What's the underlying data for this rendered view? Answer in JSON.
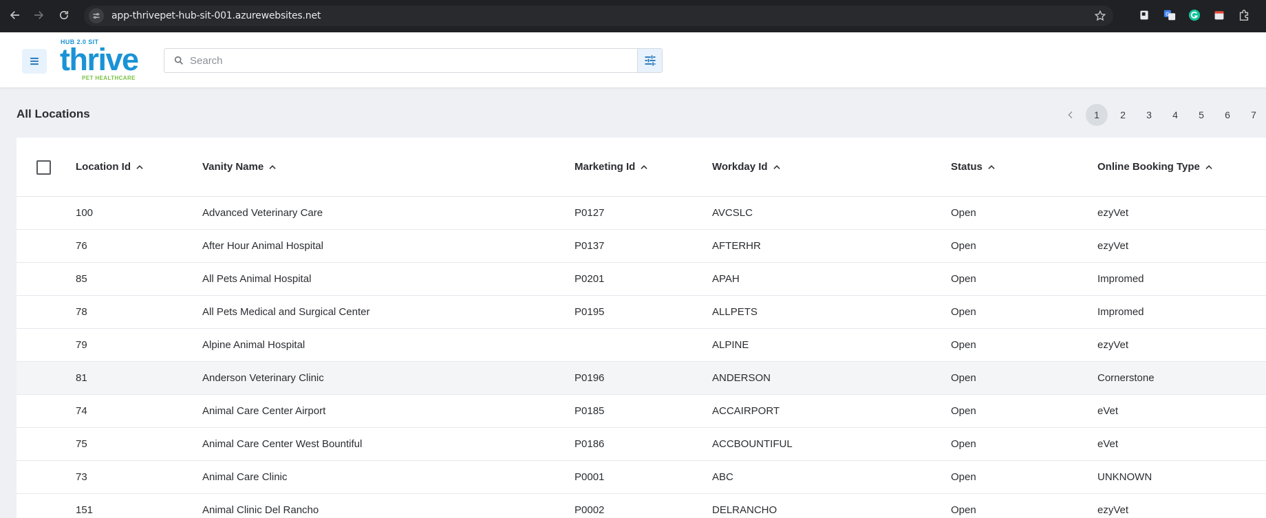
{
  "browser": {
    "url": "app-thrivepet-hub-sit-001.azurewebsites.net"
  },
  "header": {
    "logo_sub": "HUB 2.0 SIT",
    "logo_word": "thrive",
    "logo_tag": "PET HEALTHCARE",
    "search_placeholder": "Search"
  },
  "page": {
    "title": "All Locations"
  },
  "pagination": {
    "pages": [
      "1",
      "2",
      "3",
      "4",
      "5",
      "6",
      "7"
    ],
    "current": "1"
  },
  "table": {
    "columns": [
      "Location Id",
      "Vanity Name",
      "Marketing Id",
      "Workday Id",
      "Status",
      "Online Booking Type"
    ],
    "rows": [
      [
        "100",
        "Advanced Veterinary Care",
        "P0127",
        "AVCSLC",
        "Open",
        "ezyVet"
      ],
      [
        "76",
        "After Hour Animal Hospital",
        "P0137",
        "AFTERHR",
        "Open",
        "ezyVet"
      ],
      [
        "85",
        "All Pets Animal Hospital",
        "P0201",
        "APAH",
        "Open",
        "Impromed"
      ],
      [
        "78",
        "All Pets Medical and Surgical Center",
        "P0195",
        "ALLPETS",
        "Open",
        "Impromed"
      ],
      [
        "79",
        "Alpine Animal Hospital",
        "",
        "ALPINE",
        "Open",
        "ezyVet"
      ],
      [
        "81",
        "Anderson Veterinary Clinic",
        "P0196",
        "ANDERSON",
        "Open",
        "Cornerstone"
      ],
      [
        "74",
        "Animal Care Center Airport",
        "P0185",
        "ACCAIRPORT",
        "Open",
        "eVet"
      ],
      [
        "75",
        "Animal Care Center West Bountiful",
        "P0186",
        "ACCBOUNTIFUL",
        "Open",
        "eVet"
      ],
      [
        "73",
        "Animal Care Clinic",
        "P0001",
        "ABC",
        "Open",
        "UNKNOWN"
      ],
      [
        "151",
        "Animal Clinic Del Rancho",
        "P0002",
        "DELRANCHO",
        "Open",
        "ezyVet"
      ]
    ]
  },
  "colors": {
    "brand_blue": "#1a93d6",
    "brand_green": "#7ac143",
    "chrome_bg": "#202124"
  }
}
